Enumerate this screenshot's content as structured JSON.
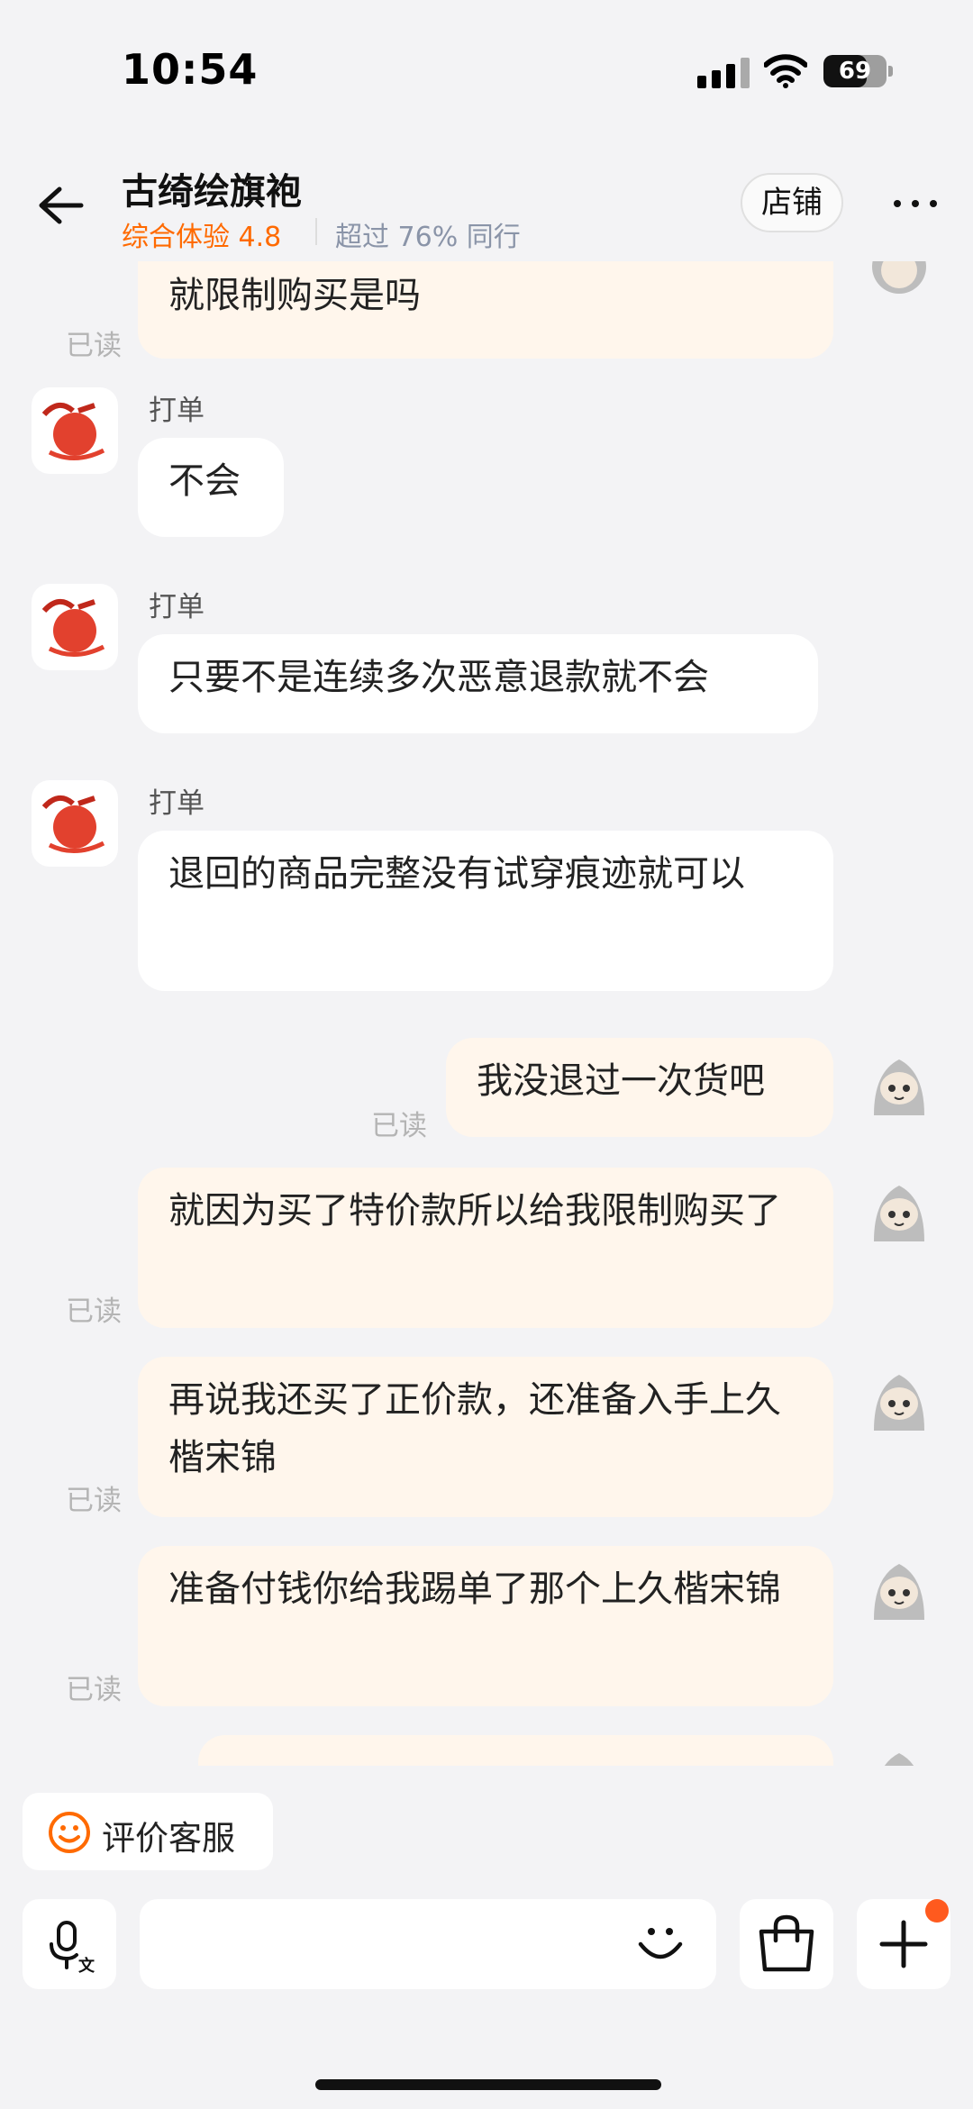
{
  "status_bar": {
    "time": "10:54",
    "battery": "69",
    "battery_level": 0.69
  },
  "header": {
    "shop_name": "古绮绘旗袍",
    "rating": "综合体验 4.8",
    "peer_compare": "超过 76% 同行",
    "store_button": "店铺"
  },
  "chat": {
    "top_partial_text": "就限制购买是吗",
    "read_label": "已读",
    "messages": [
      {
        "sender": "打单",
        "text": "不会"
      },
      {
        "sender": "打单",
        "text": "只要不是连续多次恶意退款就不会"
      },
      {
        "sender": "打单",
        "text": "退回的商品完整没有试穿痕迹就可以"
      },
      {
        "text": "我没退过一次货吧"
      },
      {
        "text": "就因为买了特价款所以给我限制购买了"
      },
      {
        "text": "再说我还买了正价款，还准备入手上久楷宋锦"
      },
      {
        "text": "准备付钱你给我踢单了那个上久楷宋锦"
      }
    ]
  },
  "footer": {
    "eval_button": "评价客服"
  },
  "icons": [
    "back-arrow-icon",
    "more-icon",
    "smiley-icon",
    "voice-translate-icon",
    "emoji-icon",
    "shopping-bag-icon",
    "plus-icon"
  ],
  "colors": {
    "accent": "#ff6a00",
    "incoming_bubble": "#ffffff",
    "outgoing_bubble": "#fff6ec",
    "badge": "#ff5a1e"
  }
}
